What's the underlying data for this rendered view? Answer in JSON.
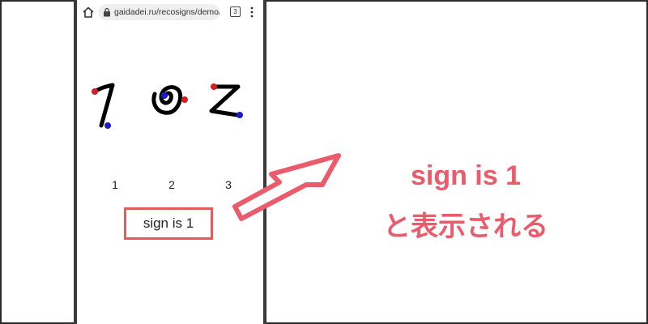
{
  "browser": {
    "url": "gaidadei.ru/recosigns/demo/",
    "tab_count": "3"
  },
  "canvas": {
    "stroke_color": "#000000",
    "start_dot_color": "#d42020",
    "end_dot_color": "#1a1acc"
  },
  "sign_labels": [
    "1",
    "2",
    "3"
  ],
  "result": {
    "text": "sign is 1"
  },
  "annotation": {
    "line1": "sign is 1",
    "line2": "と表示される",
    "color": "#ea5b6b"
  },
  "icons": {
    "home": "home-icon",
    "lock": "lock-icon",
    "tabs": "tab-count-icon",
    "menu": "more-vert-icon"
  }
}
